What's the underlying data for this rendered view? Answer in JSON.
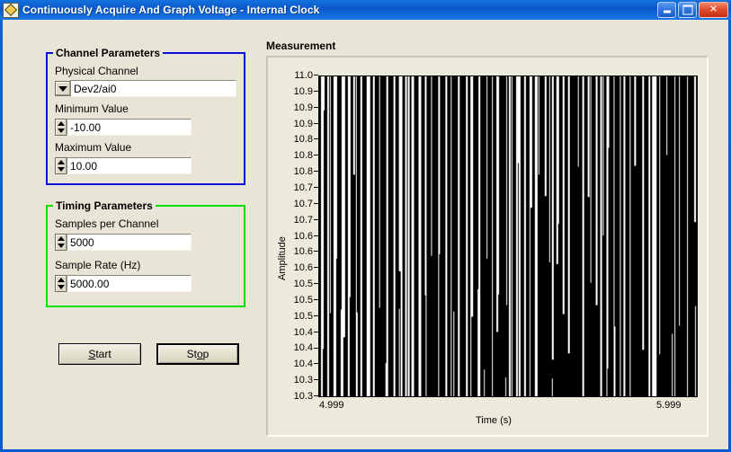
{
  "window": {
    "title": "Continuously Acquire And Graph Voltage - Internal Clock",
    "icon": "labview-vi-icon",
    "minimize_label": "",
    "maximize_label": "",
    "close_label": "✕",
    "background_color": "#e9e5d6",
    "titlebar_color": "#0a5fd4"
  },
  "channel_parameters": {
    "group_title": "Channel Parameters",
    "border_color": "#0b0bd6",
    "physical_channel": {
      "label": "Physical Channel",
      "value": "Dev2/ai0",
      "dropdown_icon": "chevron-down-icon"
    },
    "minimum_value": {
      "label": "Minimum Value",
      "value": "-10.00"
    },
    "maximum_value": {
      "label": "Maximum Value",
      "value": "10.00"
    }
  },
  "timing_parameters": {
    "group_title": "Timing Parameters",
    "border_color": "#00e000",
    "samples_per_channel": {
      "label": "Samples per Channel",
      "value": "5000"
    },
    "sample_rate": {
      "label": "Sample Rate (Hz)",
      "value": "5000.00"
    }
  },
  "buttons": {
    "start": {
      "label": "Start",
      "mnemonic": "S",
      "focused": false
    },
    "stop": {
      "label": "Stop",
      "mnemonic": "o",
      "focused": true
    }
  },
  "graph": {
    "title": "Measurement"
  },
  "chart_data": {
    "type": "line",
    "title": "Measurement",
    "xlabel": "Time (s)",
    "ylabel": "Amplitude",
    "xlim": [
      4.999,
      5.999
    ],
    "ylim": [
      10.3,
      11.0
    ],
    "grid": false,
    "legend": "none",
    "trace_color": "#000000",
    "plot_background": "#ffffff",
    "x_tick_labels": [
      "4.999",
      "5.999"
    ],
    "y_tick_labels": [
      "11.0",
      "10.9",
      "10.9",
      "10.9",
      "10.8",
      "10.8",
      "10.8",
      "10.7",
      "10.7",
      "10.7",
      "10.6",
      "10.6",
      "10.6",
      "10.5",
      "10.5",
      "10.5",
      "10.4",
      "10.4",
      "10.4",
      "10.3",
      "10.3"
    ],
    "description": "Dense aliased high-frequency voltage waveform rendered as closely packed vertical strokes spanning the full amplitude range.",
    "series": [
      {
        "name": "Voltage",
        "x": [
          4.999,
          5.999
        ],
        "values": [
          10.3,
          11.0
        ],
        "aliased_strokes": 58,
        "min": 10.3,
        "max": 11.0
      }
    ]
  }
}
